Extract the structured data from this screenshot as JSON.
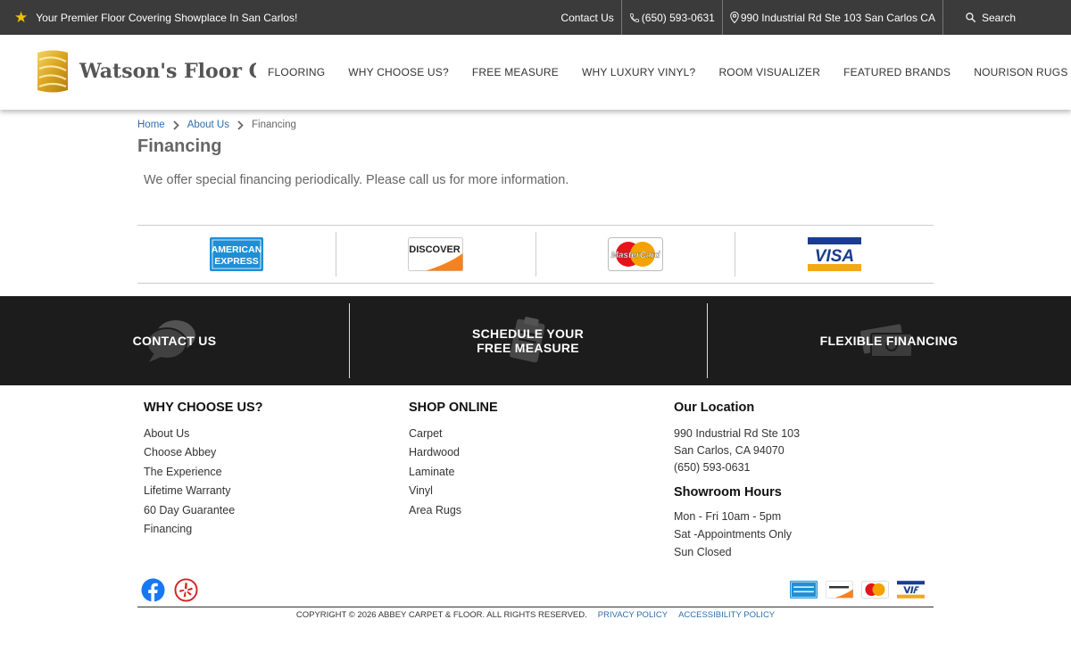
{
  "topbar": {
    "promo_text": "Your Premier Floor Covering Showplace In San Carlos!",
    "contact_label": "Contact Us",
    "phone": "(650) 593-0631",
    "address": "990 Industrial Rd Ste 103 San Carlos CA",
    "search_label": "Search",
    "bg_color": "#3b3b3b",
    "star_color": "#f2c200"
  },
  "header": {
    "logo_text": "Watson's Floor Covering",
    "nav": [
      "FLOORING",
      "WHY CHOOSE US?",
      "FREE MEASURE",
      "WHY LUXURY VINYL?",
      "ROOM VISUALIZER",
      "FEATURED BRANDS",
      "NOURISON RUGS"
    ]
  },
  "breadcrumb": {
    "home": "Home",
    "about": "About Us",
    "current": "Financing"
  },
  "page": {
    "title": "Financing",
    "intro": "We offer special financing periodically. Please call us for more information."
  },
  "cards": {
    "amex_line1": "AMERICAN",
    "amex_line2": "EXPRESS",
    "discover": "DISCOVER",
    "mastercard": "MasterCard",
    "visa": "VISA"
  },
  "cta": {
    "contact": "CONTACT US",
    "schedule_line1": "SCHEDULE YOUR",
    "schedule_line2": "FREE MEASURE",
    "financing": "FLEXIBLE FINANCING",
    "bg_color": "#1c1c1c"
  },
  "footer": {
    "why_title": "WHY CHOOSE US?",
    "why_links": [
      "About Us",
      "Choose Abbey",
      "The Experience",
      "Lifetime Warranty",
      "60 Day Guarantee",
      "Financing"
    ],
    "shop_title": "SHOP ONLINE",
    "shop_links": [
      "Carpet",
      "Hardwood",
      "Laminate",
      "Vinyl",
      "Area Rugs"
    ],
    "location_title": "Our Location",
    "address_line1": "990 Industrial Rd Ste 103",
    "address_line2": "San Carlos, CA 94070",
    "phone": "(650) 593-0631",
    "hours_title": "Showroom Hours",
    "hours": [
      "Mon - Fri 10am - 5pm",
      "Sat -Appointments Only",
      "Sun Closed"
    ],
    "copyright": "COPYRIGHT © 2026 ABBEY CARPET & FLOOR. ALL RIGHTS RESERVED.",
    "privacy": "PRIVACY POLICY",
    "accessibility": "ACCESSIBILITY POLICY",
    "link_color": "#2f6fad"
  },
  "icons": [
    "star-icon",
    "phone-icon",
    "map-pin-icon",
    "search-icon",
    "chevron-right-icon",
    "chat-bubbles-icon",
    "clipboard-icon",
    "money-icon",
    "facebook-icon",
    "yelp-icon"
  ]
}
